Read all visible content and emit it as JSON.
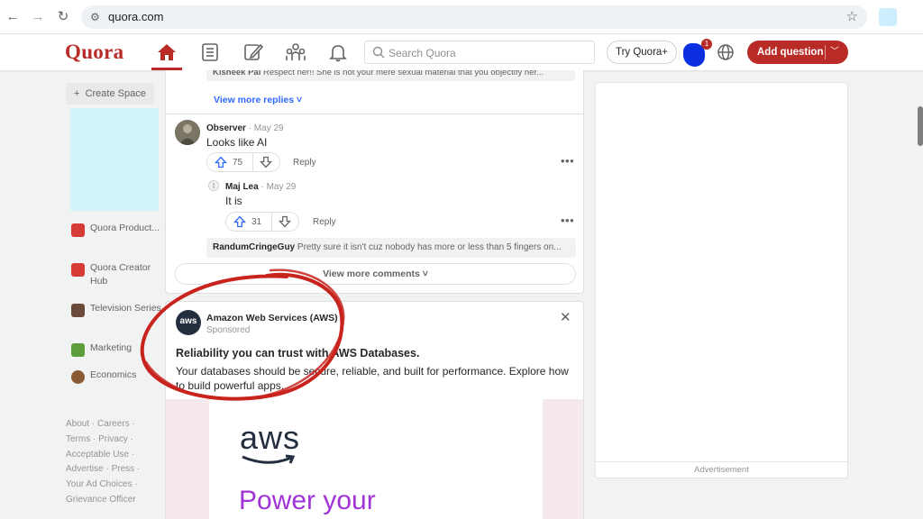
{
  "browser": {
    "back_icon": "arrow-left-icon",
    "forward_icon": "arrow-right-icon",
    "reload_icon": "reload-icon",
    "url": "quora.com",
    "bookmark_icon": "star-icon"
  },
  "header": {
    "logo": "Quora",
    "search_placeholder": "Search Quora",
    "try_label": "Try Quora+",
    "notification_count": "1",
    "add_question_label": "Add question",
    "accent_color": "#b92b27"
  },
  "sidebar": {
    "create_space": "Create Space",
    "spaces": [
      {
        "label": "Quora Product...",
        "color": "#d73b35"
      },
      {
        "label": "Quora Creator Hub",
        "color": "#d73b35"
      },
      {
        "label": "Television Series",
        "color": "#6b4a3a"
      },
      {
        "label": "Marketing",
        "color": "#5b9e3b"
      },
      {
        "label": "Economics",
        "color": "#8a5a34"
      }
    ],
    "footer": [
      "About ·",
      "Careers ·",
      "Terms ·",
      "Privacy ·",
      "Acceptable Use ·",
      "Advertise ·",
      "Press ·",
      "Your Ad Choices ·",
      "Grievance Officer"
    ]
  },
  "feed": {
    "prev_snippet_name": "Kisneek Pal",
    "prev_snippet_text": "Respect her!! She is not your mere sexual material that you objectify her...",
    "view_more_replies": "View more replies",
    "comment": {
      "author": "Observer",
      "date": "· May 29",
      "text": "Looks like AI",
      "upvotes": "75",
      "reply_label": "Reply"
    },
    "reply": {
      "author": "Maj Lea",
      "date": "· May 29",
      "text": "It is",
      "upvotes": "31",
      "reply_label": "Reply"
    },
    "reply_snippet_name": "RandumCringeGuy",
    "reply_snippet_text": "Pretty sure it isn't cuz nobody has more or less than 5 fingers on...",
    "view_more_comments": "View more comments"
  },
  "ad": {
    "logo_text": "aws",
    "advertiser": "Amazon Web Services (AWS)",
    "sponsored": "Sponsored",
    "headline": "Reliability you can trust with AWS Databases.",
    "body": "Your databases should be secure, reliable, and built for performance. Explore how to build powerful apps.",
    "image_brand": "aws",
    "image_text": "Power your"
  },
  "right_column": {
    "ad_label": "Advertisement"
  }
}
